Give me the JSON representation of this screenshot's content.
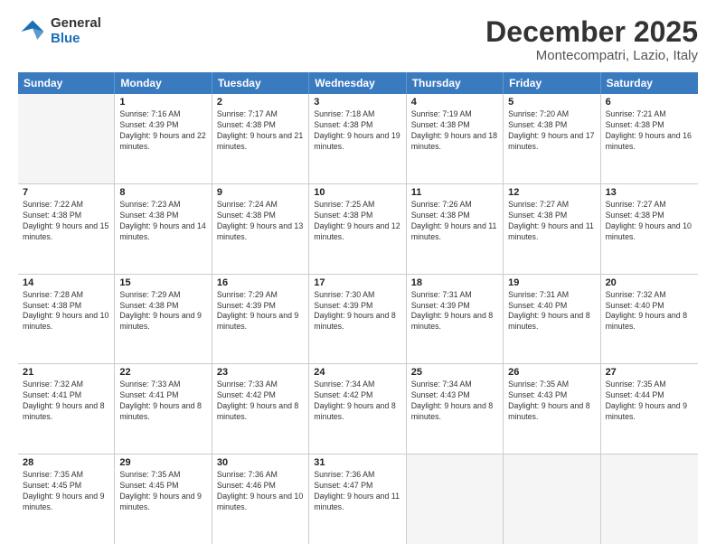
{
  "logo": {
    "general": "General",
    "blue": "Blue"
  },
  "title": "December 2025",
  "subtitle": "Montecompatri, Lazio, Italy",
  "header_days": [
    "Sunday",
    "Monday",
    "Tuesday",
    "Wednesday",
    "Thursday",
    "Friday",
    "Saturday"
  ],
  "weeks": [
    [
      {
        "day": "",
        "sunrise": "",
        "sunset": "",
        "daylight": "",
        "empty": true
      },
      {
        "day": "1",
        "sunrise": "Sunrise: 7:16 AM",
        "sunset": "Sunset: 4:39 PM",
        "daylight": "Daylight: 9 hours and 22 minutes."
      },
      {
        "day": "2",
        "sunrise": "Sunrise: 7:17 AM",
        "sunset": "Sunset: 4:38 PM",
        "daylight": "Daylight: 9 hours and 21 minutes."
      },
      {
        "day": "3",
        "sunrise": "Sunrise: 7:18 AM",
        "sunset": "Sunset: 4:38 PM",
        "daylight": "Daylight: 9 hours and 19 minutes."
      },
      {
        "day": "4",
        "sunrise": "Sunrise: 7:19 AM",
        "sunset": "Sunset: 4:38 PM",
        "daylight": "Daylight: 9 hours and 18 minutes."
      },
      {
        "day": "5",
        "sunrise": "Sunrise: 7:20 AM",
        "sunset": "Sunset: 4:38 PM",
        "daylight": "Daylight: 9 hours and 17 minutes."
      },
      {
        "day": "6",
        "sunrise": "Sunrise: 7:21 AM",
        "sunset": "Sunset: 4:38 PM",
        "daylight": "Daylight: 9 hours and 16 minutes."
      }
    ],
    [
      {
        "day": "7",
        "sunrise": "Sunrise: 7:22 AM",
        "sunset": "Sunset: 4:38 PM",
        "daylight": "Daylight: 9 hours and 15 minutes."
      },
      {
        "day": "8",
        "sunrise": "Sunrise: 7:23 AM",
        "sunset": "Sunset: 4:38 PM",
        "daylight": "Daylight: 9 hours and 14 minutes."
      },
      {
        "day": "9",
        "sunrise": "Sunrise: 7:24 AM",
        "sunset": "Sunset: 4:38 PM",
        "daylight": "Daylight: 9 hours and 13 minutes."
      },
      {
        "day": "10",
        "sunrise": "Sunrise: 7:25 AM",
        "sunset": "Sunset: 4:38 PM",
        "daylight": "Daylight: 9 hours and 12 minutes."
      },
      {
        "day": "11",
        "sunrise": "Sunrise: 7:26 AM",
        "sunset": "Sunset: 4:38 PM",
        "daylight": "Daylight: 9 hours and 11 minutes."
      },
      {
        "day": "12",
        "sunrise": "Sunrise: 7:27 AM",
        "sunset": "Sunset: 4:38 PM",
        "daylight": "Daylight: 9 hours and 11 minutes."
      },
      {
        "day": "13",
        "sunrise": "Sunrise: 7:27 AM",
        "sunset": "Sunset: 4:38 PM",
        "daylight": "Daylight: 9 hours and 10 minutes."
      }
    ],
    [
      {
        "day": "14",
        "sunrise": "Sunrise: 7:28 AM",
        "sunset": "Sunset: 4:38 PM",
        "daylight": "Daylight: 9 hours and 10 minutes."
      },
      {
        "day": "15",
        "sunrise": "Sunrise: 7:29 AM",
        "sunset": "Sunset: 4:38 PM",
        "daylight": "Daylight: 9 hours and 9 minutes."
      },
      {
        "day": "16",
        "sunrise": "Sunrise: 7:29 AM",
        "sunset": "Sunset: 4:39 PM",
        "daylight": "Daylight: 9 hours and 9 minutes."
      },
      {
        "day": "17",
        "sunrise": "Sunrise: 7:30 AM",
        "sunset": "Sunset: 4:39 PM",
        "daylight": "Daylight: 9 hours and 8 minutes."
      },
      {
        "day": "18",
        "sunrise": "Sunrise: 7:31 AM",
        "sunset": "Sunset: 4:39 PM",
        "daylight": "Daylight: 9 hours and 8 minutes."
      },
      {
        "day": "19",
        "sunrise": "Sunrise: 7:31 AM",
        "sunset": "Sunset: 4:40 PM",
        "daylight": "Daylight: 9 hours and 8 minutes."
      },
      {
        "day": "20",
        "sunrise": "Sunrise: 7:32 AM",
        "sunset": "Sunset: 4:40 PM",
        "daylight": "Daylight: 9 hours and 8 minutes."
      }
    ],
    [
      {
        "day": "21",
        "sunrise": "Sunrise: 7:32 AM",
        "sunset": "Sunset: 4:41 PM",
        "daylight": "Daylight: 9 hours and 8 minutes."
      },
      {
        "day": "22",
        "sunrise": "Sunrise: 7:33 AM",
        "sunset": "Sunset: 4:41 PM",
        "daylight": "Daylight: 9 hours and 8 minutes."
      },
      {
        "day": "23",
        "sunrise": "Sunrise: 7:33 AM",
        "sunset": "Sunset: 4:42 PM",
        "daylight": "Daylight: 9 hours and 8 minutes."
      },
      {
        "day": "24",
        "sunrise": "Sunrise: 7:34 AM",
        "sunset": "Sunset: 4:42 PM",
        "daylight": "Daylight: 9 hours and 8 minutes."
      },
      {
        "day": "25",
        "sunrise": "Sunrise: 7:34 AM",
        "sunset": "Sunset: 4:43 PM",
        "daylight": "Daylight: 9 hours and 8 minutes."
      },
      {
        "day": "26",
        "sunrise": "Sunrise: 7:35 AM",
        "sunset": "Sunset: 4:43 PM",
        "daylight": "Daylight: 9 hours and 8 minutes."
      },
      {
        "day": "27",
        "sunrise": "Sunrise: 7:35 AM",
        "sunset": "Sunset: 4:44 PM",
        "daylight": "Daylight: 9 hours and 9 minutes."
      }
    ],
    [
      {
        "day": "28",
        "sunrise": "Sunrise: 7:35 AM",
        "sunset": "Sunset: 4:45 PM",
        "daylight": "Daylight: 9 hours and 9 minutes."
      },
      {
        "day": "29",
        "sunrise": "Sunrise: 7:35 AM",
        "sunset": "Sunset: 4:45 PM",
        "daylight": "Daylight: 9 hours and 9 minutes."
      },
      {
        "day": "30",
        "sunrise": "Sunrise: 7:36 AM",
        "sunset": "Sunset: 4:46 PM",
        "daylight": "Daylight: 9 hours and 10 minutes."
      },
      {
        "day": "31",
        "sunrise": "Sunrise: 7:36 AM",
        "sunset": "Sunset: 4:47 PM",
        "daylight": "Daylight: 9 hours and 11 minutes."
      },
      {
        "day": "",
        "sunrise": "",
        "sunset": "",
        "daylight": "",
        "empty": true
      },
      {
        "day": "",
        "sunrise": "",
        "sunset": "",
        "daylight": "",
        "empty": true
      },
      {
        "day": "",
        "sunrise": "",
        "sunset": "",
        "daylight": "",
        "empty": true
      }
    ]
  ]
}
